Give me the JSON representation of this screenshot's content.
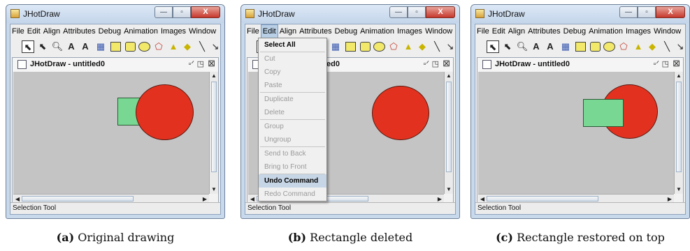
{
  "window": {
    "app_title": "JHotDraw"
  },
  "menus": [
    "File",
    "Edit",
    "Align",
    "Attributes",
    "Debug",
    "Animation",
    "Images",
    "Window"
  ],
  "inner_window": {
    "title": "JHotDraw - untitled0"
  },
  "status": "Selection Tool",
  "edit_menu": [
    {
      "label": "Select All",
      "enabled": true
    },
    {
      "sep": true
    },
    {
      "label": "Cut",
      "enabled": false
    },
    {
      "label": "Copy",
      "enabled": false
    },
    {
      "label": "Paste",
      "enabled": false
    },
    {
      "sep": true
    },
    {
      "label": "Duplicate",
      "enabled": false
    },
    {
      "label": "Delete",
      "enabled": false
    },
    {
      "sep": true
    },
    {
      "label": "Group",
      "enabled": false
    },
    {
      "label": "Ungroup",
      "enabled": false
    },
    {
      "sep": true
    },
    {
      "label": "Send to Back",
      "enabled": false
    },
    {
      "label": "Bring to Front",
      "enabled": false
    },
    {
      "sep": true
    },
    {
      "label": "Undo Command",
      "enabled": true,
      "highlighted": true
    },
    {
      "label": "Redo Command",
      "enabled": false
    }
  ],
  "panels": [
    {
      "caption_letter": "(a)",
      "caption_text": "Original drawing"
    },
    {
      "caption_letter": "(b)",
      "caption_text": "Rectangle deleted"
    },
    {
      "caption_letter": "(c)",
      "caption_text": "Rectangle restored on top"
    }
  ],
  "colors": {
    "circle": "#e2321f",
    "rectangle": "#78d893",
    "canvas": "#c4c4c4"
  }
}
